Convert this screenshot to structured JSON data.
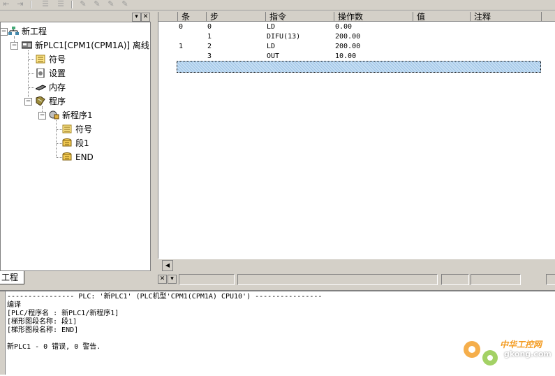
{
  "project_tree": {
    "tab_label": "工程",
    "root": "新工程",
    "plc": "新PLC1[CPM1(CPM1A)] 离线",
    "symbols": "符号",
    "settings": "设置",
    "memory": "内存",
    "programs": "程序",
    "new_program": "新程序1",
    "program_symbols": "符号",
    "section1": "段1",
    "end": "END"
  },
  "mnemonic_table": {
    "columns": [
      "条",
      "步",
      "指令",
      "操作数",
      "值",
      "注释"
    ],
    "rows": [
      {
        "rung": "0",
        "step": "0",
        "instruction": "LD",
        "operand": "0.00"
      },
      {
        "rung": "",
        "step": "1",
        "instruction": "DIFU(13)",
        "operand": "200.00"
      },
      {
        "rung": "1",
        "step": "2",
        "instruction": "LD",
        "operand": "200.00"
      },
      {
        "rung": "",
        "step": "3",
        "instruction": "OUT",
        "operand": "10.00"
      }
    ]
  },
  "output": {
    "lines": [
      "---------------- PLC: '新PLC1' (PLC机型'CPM1(CPM1A) CPU10') ----------------",
      "编译",
      "[PLC/程序名 : 新PLC1/新程序1]",
      "[梯形图段名称: 段1]",
      "[梯形图段名称: END]",
      "",
      "新PLC1 - 0 错误, 0 警告."
    ]
  },
  "watermark": {
    "cn": "中华工控网",
    "url": "gkong.com"
  },
  "colors": {
    "selection": "#9ec3e6",
    "watermark_orange": "#f39a1e",
    "watermark_green": "#8cc63f"
  }
}
